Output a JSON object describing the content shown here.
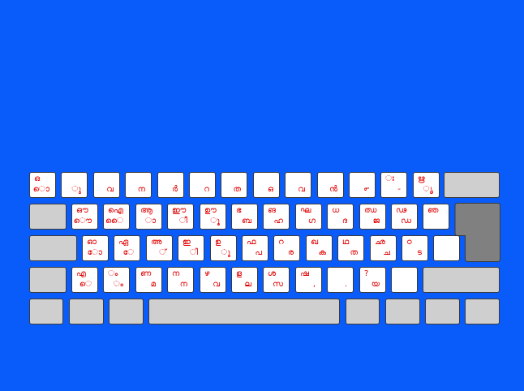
{
  "keyboard": {
    "rows": [
      [
        {
          "u": "ഒ",
          "l": "ൊ"
        },
        {
          "u": "",
          "l": "ു"
        },
        {
          "u": "",
          "l": "വ"
        },
        {
          "u": "",
          "l": "ന"
        },
        {
          "u": "",
          "l": "ർ"
        },
        {
          "u": "",
          "l": "റ"
        },
        {
          "u": "",
          "l": "ത"
        },
        {
          "u": "",
          "l": "ഒ"
        },
        {
          "u": "",
          "l": "വ"
        },
        {
          "u": "",
          "l": "ൻ"
        },
        {
          "u": "",
          "l": "൳"
        },
        {
          "u": "ഃ",
          "l": "-"
        },
        {
          "u": "ഋ",
          "l": "ൃ"
        }
      ],
      [
        {
          "u": "ഔ",
          "l": "ൌ"
        },
        {
          "u": "ഐ",
          "l": "ൈ"
        },
        {
          "u": "ആ",
          "l": "ാ"
        },
        {
          "u": "ഈ",
          "l": "ീ"
        },
        {
          "u": "ഊ",
          "l": "ൂ"
        },
        {
          "u": "ഭ",
          "l": "ബ"
        },
        {
          "u": "ങ",
          "l": "ഹ"
        },
        {
          "u": "ഘ",
          "l": "ഗ"
        },
        {
          "u": "ധ",
          "l": "ദ"
        },
        {
          "u": "ഝ",
          "l": "ജ"
        },
        {
          "u": "ഢ",
          "l": "ഡ"
        },
        {
          "u": "ഞ",
          "l": ""
        }
      ],
      [
        {
          "u": "ഓ",
          "l": "ോ"
        },
        {
          "u": "ഏ",
          "l": "േ"
        },
        {
          "u": "അ",
          "l": "്"
        },
        {
          "u": "ഇ",
          "l": "ി"
        },
        {
          "u": "ഉ",
          "l": "ു"
        },
        {
          "u": "ഫ",
          "l": "പ"
        },
        {
          "u": "റ",
          "l": "ര"
        },
        {
          "u": "ഖ",
          "l": "ക"
        },
        {
          "u": "ഥ",
          "l": "ത"
        },
        {
          "u": "ഛ",
          "l": "ച"
        },
        {
          "u": "ഠ",
          "l": "ട"
        },
        {
          "u": "",
          "l": ""
        }
      ],
      [
        {
          "u": "എ",
          "l": "െ"
        },
        {
          "u": "ം",
          "l": "ം"
        },
        {
          "u": "ണ",
          "l": "മ"
        },
        {
          "u": "ന",
          "l": "ന"
        },
        {
          "u": "ഴ",
          "l": "വ"
        },
        {
          "u": "ള",
          "l": "ല"
        },
        {
          "u": "ശ",
          "l": "സ"
        },
        {
          "u": "ഷ",
          "l": ","
        },
        {
          "u": "",
          "l": "."
        },
        {
          "u": "?",
          "l": "യ"
        },
        {
          "u": "",
          "l": ""
        }
      ]
    ]
  },
  "colors": {
    "background": "#0a5cfa",
    "key_fill": "#ffffff",
    "function_key_fill": "#cfcfcf",
    "enter_key_fill": "#808080",
    "label_color": "#e00000",
    "border": "#3a3a3a"
  }
}
